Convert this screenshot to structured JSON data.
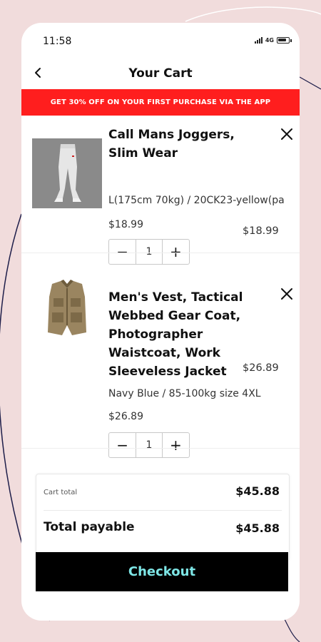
{
  "status_bar": {
    "time": "11:58",
    "network": "4G"
  },
  "header": {
    "title": "Your Cart",
    "back_icon": "chevron-left-icon"
  },
  "promo": {
    "text": "GET 30% OFF ON YOUR FIRST PURCHASE VIA THE APP"
  },
  "items": [
    {
      "name_lines": [
        "Call Mans Joggers,",
        "Slim Wear"
      ],
      "variant": "L(175cm 70kg) / 20CK23-yellow(pa",
      "unit_price": "$18.99",
      "line_price": "$18.99",
      "quantity": "1",
      "decrement": "−",
      "increment": "+"
    },
    {
      "name_lines": [
        "Men's Vest, Tactical",
        "Webbed Gear Coat,",
        "Photographer",
        "Waistcoat, Work",
        "Sleeveless Jacket"
      ],
      "variant": "Navy Blue / 85-100kg size 4XL",
      "unit_price": "$26.89",
      "line_price": "$26.89",
      "quantity": "1",
      "decrement": "−",
      "increment": "+"
    }
  ],
  "summary": {
    "cart_total_label": "Cart total",
    "cart_total_value": "$45.88",
    "payable_label": "Total payable",
    "payable_value": "$45.88"
  },
  "checkout": {
    "label": "Checkout"
  },
  "colors": {
    "promo_bg": "#ff1e1e",
    "checkout_bg": "#000000",
    "checkout_text": "#7ee6e6",
    "page_bg": "#f1dcdc"
  }
}
